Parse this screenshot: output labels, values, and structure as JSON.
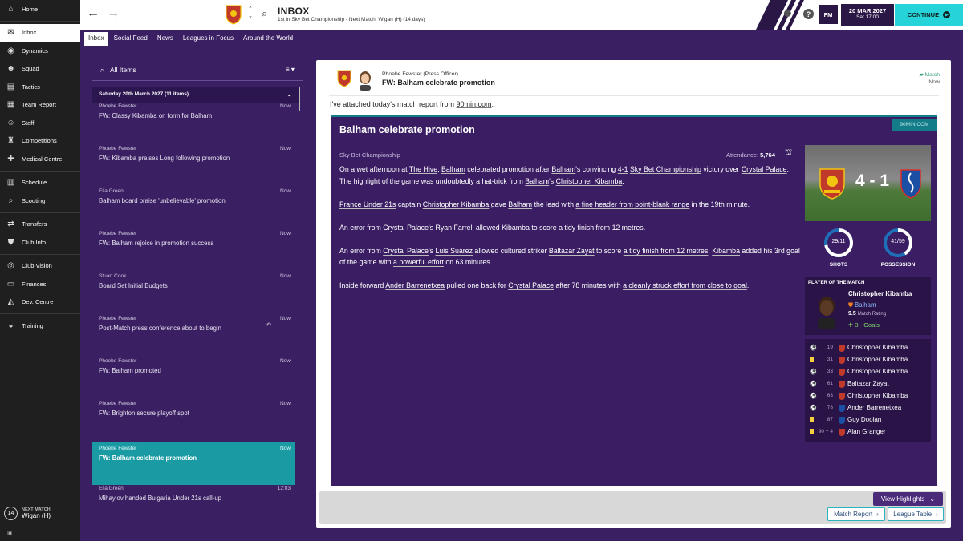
{
  "sidebar": {
    "items": [
      {
        "label": "Home",
        "icon": "home-icon",
        "glyph": "⌂"
      },
      {
        "label": "Inbox",
        "icon": "inbox-icon",
        "glyph": "✉"
      },
      {
        "label": "Dynamics",
        "icon": "dynamics-icon",
        "glyph": "◉"
      },
      {
        "label": "Squad",
        "icon": "squad-icon",
        "glyph": "☻"
      },
      {
        "label": "Tactics",
        "icon": "tactics-icon",
        "glyph": "▤"
      },
      {
        "label": "Team Report",
        "icon": "team-report-icon",
        "glyph": "▦"
      },
      {
        "label": "Staff",
        "icon": "staff-icon",
        "glyph": "☺"
      },
      {
        "label": "Competitions",
        "icon": "competitions-icon",
        "glyph": "♜"
      },
      {
        "label": "Medical Centre",
        "icon": "medical-icon",
        "glyph": "✚"
      },
      {
        "label": "Schedule",
        "icon": "schedule-icon",
        "glyph": "▥"
      },
      {
        "label": "Scouting",
        "icon": "scouting-icon",
        "glyph": "⌕"
      },
      {
        "label": "Transfers",
        "icon": "transfers-icon",
        "glyph": "⇄"
      },
      {
        "label": "Club Info",
        "icon": "club-info-icon",
        "glyph": "⛊"
      },
      {
        "label": "Club Vision",
        "icon": "club-vision-icon",
        "glyph": "◎"
      },
      {
        "label": "Finances",
        "icon": "finances-icon",
        "glyph": "▭"
      },
      {
        "label": "Dev. Centre",
        "icon": "dev-centre-icon",
        "glyph": "◭"
      },
      {
        "label": "Training",
        "icon": "training-icon",
        "glyph": "◒"
      }
    ],
    "next_match_num": "14",
    "next_match_label": "NEXT MATCH",
    "next_match_value": "Wigan (H)"
  },
  "topbar": {
    "title": "INBOX",
    "subtitle": "1st in Sky Bet Championship - Next Match: Wigan (H) (14 days)",
    "fm_label": "FM",
    "date": "20 MAR 2027",
    "time": "Sat 17:00",
    "continue_label": "CONTINUE"
  },
  "tabs": [
    "Inbox",
    "Social Feed",
    "News",
    "Leagues in Focus",
    "Around the World"
  ],
  "inbox": {
    "filter_label": "All Items",
    "group_label": "Saturday 20th March 2027 (11 items)",
    "messages": [
      {
        "sender": "Phoebe Fewster",
        "subject": "FW: Classy Kibamba on form for Balham",
        "time": "Now"
      },
      {
        "sender": "Phoebe Fewster",
        "subject": "FW: Kibamba praises Long following promotion",
        "time": "Now"
      },
      {
        "sender": "Ella Green",
        "subject": "Balham board praise 'unbelievable' promotion",
        "time": "Now"
      },
      {
        "sender": "Phoebe Fewster",
        "subject": "FW: Balham rejoice in promotion success",
        "time": "Now"
      },
      {
        "sender": "Stuart Cook",
        "subject": "Board Set Initial Budgets",
        "time": "Now"
      },
      {
        "sender": "Phoebe Fewster",
        "subject": "Post-Match press conference about to begin",
        "time": "Now"
      },
      {
        "sender": "Phoebe Fewster",
        "subject": "FW: Balham promoted",
        "time": "Now"
      },
      {
        "sender": "Phoebe Fewster",
        "subject": "FW: Brighton secure playoff spot",
        "time": "Now"
      },
      {
        "sender": "Phoebe Fewster",
        "subject": "FW: Balham celebrate promotion",
        "time": "Now"
      },
      {
        "sender": "Ella Green",
        "subject": "Mihaylov handed Bulgaria Under 21s call-up",
        "time": "12:03"
      }
    ]
  },
  "message": {
    "sender": "Phoebe Fewster  (Press Officer)",
    "subject": "FW: Balham celebrate promotion",
    "match_link": "Match",
    "time": "Now",
    "intro_pre": "I've attached today's match report from ",
    "intro_link": "90min.com",
    "intro_post": ":"
  },
  "report": {
    "title": "Balham celebrate promotion",
    "source": "90MIN.COM",
    "competition": "Sky Bet Championship",
    "attendance_label": "Attendance:",
    "attendance": "5,764",
    "paragraphs": [
      [
        {
          "t": "On a wet afternoon at "
        },
        {
          "t": "The Hive",
          "u": true
        },
        {
          "t": ", "
        },
        {
          "t": "Balham",
          "u": true
        },
        {
          "t": " celebrated promotion after "
        },
        {
          "t": "Balham",
          "u": true
        },
        {
          "t": "'s convincing "
        },
        {
          "t": "4-1",
          "u": true
        },
        {
          "t": " "
        },
        {
          "t": "Sky Bet Championship",
          "u": true
        },
        {
          "t": " victory over "
        },
        {
          "t": "Crystal Palace",
          "u": true
        },
        {
          "t": ". The highlight of the game was undoubtedly a hat-trick from "
        },
        {
          "t": "Balham",
          "u": true
        },
        {
          "t": "'s "
        },
        {
          "t": "Christopher Kibamba",
          "u": true
        },
        {
          "t": "."
        }
      ],
      [
        {
          "t": "France Under 21s",
          "u": true
        },
        {
          "t": " captain "
        },
        {
          "t": "Christopher Kibamba",
          "u": true
        },
        {
          "t": " gave "
        },
        {
          "t": "Balham",
          "u": true
        },
        {
          "t": " the lead with "
        },
        {
          "t": "a fine header from point-blank range",
          "u": true
        },
        {
          "t": " in the 19th minute."
        }
      ],
      [
        {
          "t": "An error from "
        },
        {
          "t": "Crystal Palace",
          "u": true
        },
        {
          "t": "'s "
        },
        {
          "t": "Ryan Farrell",
          "u": true
        },
        {
          "t": " allowed "
        },
        {
          "t": "Kibamba",
          "u": true
        },
        {
          "t": " to score "
        },
        {
          "t": "a tidy finish from 12 metres",
          "u": true
        },
        {
          "t": "."
        }
      ],
      [
        {
          "t": "An error from "
        },
        {
          "t": "Crystal Palace",
          "u": true
        },
        {
          "t": "'s "
        },
        {
          "t": "Luis Suárez",
          "u": true
        },
        {
          "t": " allowed cultured striker "
        },
        {
          "t": "Baltazar Zayat",
          "u": true
        },
        {
          "t": " to score "
        },
        {
          "t": "a tidy finish from 12 metres",
          "u": true
        },
        {
          "t": ". "
        },
        {
          "t": "Kibamba",
          "u": true
        },
        {
          "t": " added his 3rd goal of the game with "
        },
        {
          "t": "a powerful effort",
          "u": true
        },
        {
          "t": " on 63 minutes."
        }
      ],
      [
        {
          "t": "Inside forward "
        },
        {
          "t": "Ander Barrenetxea",
          "u": true
        },
        {
          "t": " pulled one back for "
        },
        {
          "t": "Crystal Palace",
          "u": true
        },
        {
          "t": " after 78 minutes with "
        },
        {
          "t": "a cleanly struck effort from close to goal",
          "u": true
        },
        {
          "t": "."
        }
      ]
    ],
    "score": "4 - 1",
    "shots_value": "29/11",
    "shots_label": "SHOTS",
    "shots_ratio": 0.72,
    "possession_value": "41/59",
    "possession_label": "POSSESSION",
    "possession_ratio": 0.41,
    "potm_title": "PLAYER OF THE MATCH",
    "potm_name": "Christopher Kibamba",
    "potm_club": "Balham",
    "potm_rating": "9.5",
    "potm_rating_label": "Match Rating",
    "potm_goals": "3 - Goals",
    "events": [
      {
        "minute": "19",
        "player": "Christopher Kibamba",
        "type": "goal",
        "team": "home"
      },
      {
        "minute": "31",
        "player": "Christopher Kibamba",
        "type": "yellow",
        "team": "home"
      },
      {
        "minute": "33",
        "player": "Christopher Kibamba",
        "type": "goal",
        "team": "home"
      },
      {
        "minute": "61",
        "player": "Baltazar Zayat",
        "type": "goal",
        "team": "home"
      },
      {
        "minute": "63",
        "player": "Christopher Kibamba",
        "type": "goal",
        "team": "home"
      },
      {
        "minute": "78",
        "player": "Ander Barrenetxea",
        "type": "goal",
        "team": "away"
      },
      {
        "minute": "87",
        "player": "Guy Doolan",
        "type": "yellow",
        "team": "away"
      },
      {
        "minute": "90 + 4",
        "player": "Alan Granger",
        "type": "yellow",
        "team": "home"
      }
    ]
  },
  "actions": {
    "view_highlights": "View Highlights",
    "match_report": "Match Report",
    "league_table": "League Table"
  },
  "colors": {
    "background": "#3b1f63",
    "accent": "#25d3d8",
    "selected": "#1a9ba4",
    "home_crest": "#c0392b",
    "away_crest": "#1b4fa3"
  }
}
